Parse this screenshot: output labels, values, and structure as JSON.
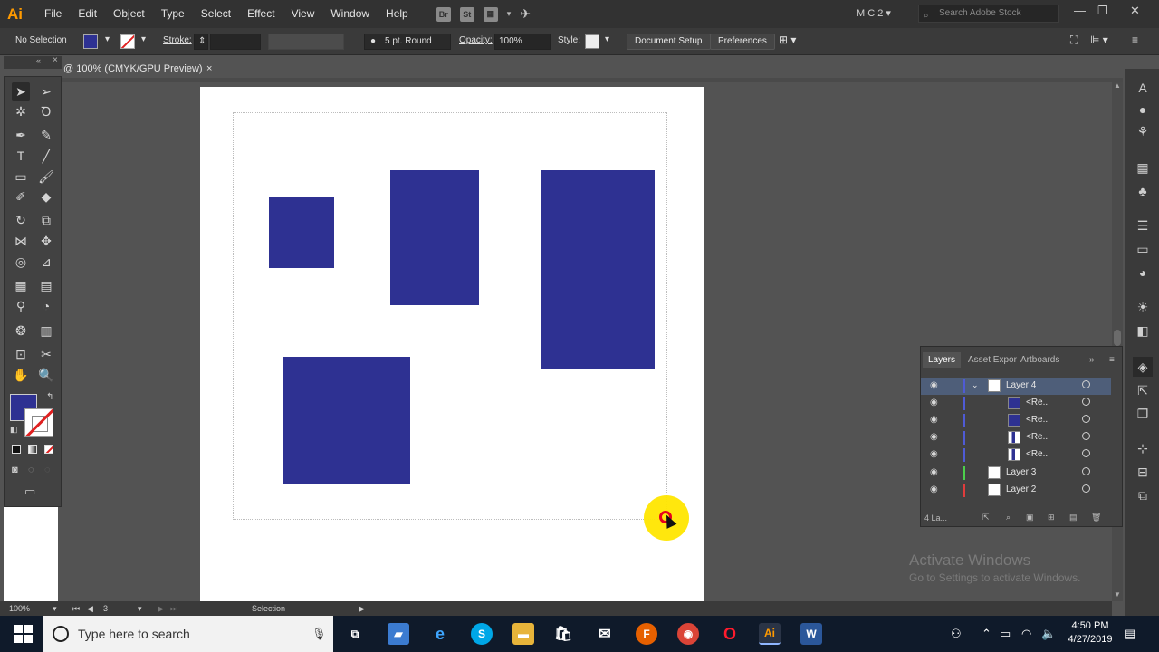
{
  "app": {
    "logo": "Ai",
    "menu": [
      "File",
      "Edit",
      "Object",
      "Type",
      "Select",
      "Effect",
      "View",
      "Window",
      "Help"
    ],
    "menu_icons": [
      "Br",
      "St"
    ],
    "workspace": "M C 2",
    "search_placeholder": "Search Adobe Stock"
  },
  "control_bar": {
    "selection_label": "No Selection",
    "stroke_label": "Stroke:",
    "brush_label": "5 pt. Round",
    "opacity_label": "Opacity:",
    "opacity_value": "100%",
    "style_label": "Style:",
    "document_setup": "Document Setup",
    "preferences": "Preferences"
  },
  "document": {
    "tab_title": "@ 100% (CMYK/GPU Preview)",
    "close": "×",
    "fill_color": "#2e3192"
  },
  "status_bar": {
    "zoom": "100%",
    "artboard_number": "3",
    "tool": "Selection"
  },
  "layers_panel": {
    "tabs": [
      "Layers",
      "Asset Expor",
      "Artboards"
    ],
    "rows": [
      {
        "name": "Layer 4",
        "color": "#4f5bd5"
      },
      {
        "name": "<Re...",
        "color": "#4f5bd5"
      },
      {
        "name": "<Re...",
        "color": "#4f5bd5"
      },
      {
        "name": "<Re...",
        "color": "#4f5bd5"
      },
      {
        "name": "<Re...",
        "color": "#4f5bd5"
      },
      {
        "name": "Layer 3",
        "color": "#4ccf4c"
      },
      {
        "name": "Layer 2",
        "color": "#e03c3c"
      }
    ],
    "footer_count": "4 La..."
  },
  "watermark": {
    "title": "Activate Windows",
    "subtitle": "Go to Settings to activate Windows."
  },
  "taskbar": {
    "search_placeholder": "Type here to search",
    "time": "4:50 PM",
    "date": "4/27/2019"
  }
}
